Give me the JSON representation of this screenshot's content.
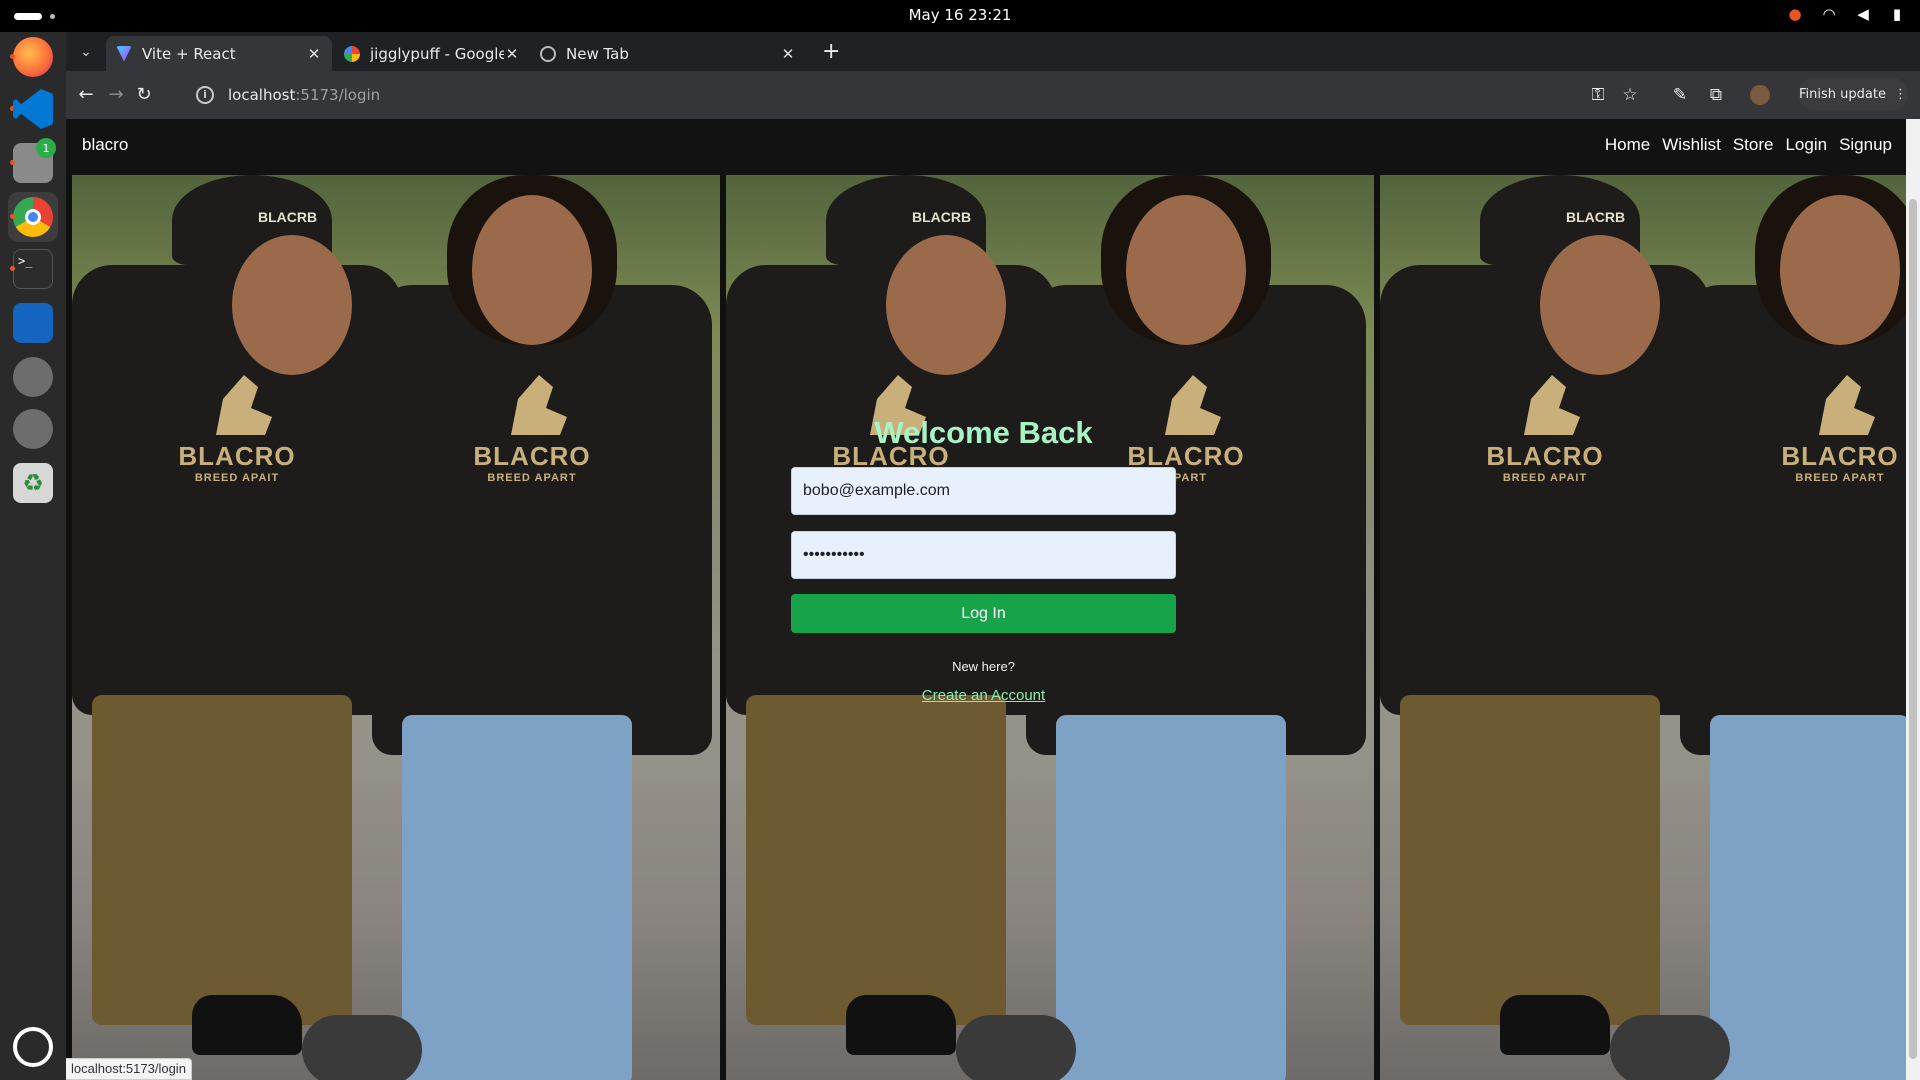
{
  "system": {
    "clock": "May 16  23:21",
    "tray": [
      "record-icon",
      "wifi-icon",
      "volume-icon",
      "battery-icon"
    ]
  },
  "dock": {
    "items": [
      {
        "name": "firefox",
        "color": "#ff7139"
      },
      {
        "name": "vscode",
        "color": "#0078d4"
      },
      {
        "name": "files",
        "color": "#8a8a8a",
        "badge": "1"
      },
      {
        "name": "chrome",
        "color": "#4285f4"
      },
      {
        "name": "terminal",
        "color": "#2c2c2c"
      },
      {
        "name": "writer",
        "color": "#1565c0"
      },
      {
        "name": "disc",
        "color": "#777"
      },
      {
        "name": "disc2",
        "color": "#777"
      },
      {
        "name": "trash",
        "color": "#3c8c3c"
      }
    ],
    "apps_icon": "ubuntu-apps-icon"
  },
  "browser": {
    "tabs": [
      {
        "title": "Vite + React",
        "favicon": "vite-icon",
        "active": true
      },
      {
        "title": "jigglypuff - Google Searc",
        "favicon": "google-icon",
        "active": false
      },
      {
        "title": "New Tab",
        "favicon": "chrome-icon",
        "active": false
      }
    ],
    "url_host": "localhost",
    "url_path": ":5173/login",
    "finish_update": "Finish update"
  },
  "site": {
    "brand": "blacro",
    "nav": [
      "Home",
      "Wishlist",
      "Store",
      "Login",
      "Signup"
    ],
    "hero_panels": [
      {
        "cap_text": "BLACRB",
        "logo": "BLACRO",
        "logo_sub": "BREED APAIT",
        "logo2": "BLACRO",
        "logo2_sub": "BREED APART"
      },
      {
        "cap_text": "BLACRB",
        "logo": "BLACRO",
        "logo_sub": "BR",
        "logo2": "BLACRO",
        "logo2_sub": "APART"
      },
      {
        "cap_text": "BLACRB",
        "logo": "BLACRO",
        "logo_sub": "BREED APAIT",
        "logo2": "BLACRO",
        "logo2_sub": "BREED APART"
      }
    ],
    "login": {
      "title": "Welcome Back",
      "email_value": "bobo@example.com",
      "password_value": "•••••••••••",
      "submit_label": "Log In",
      "new_here": "New here?",
      "create_account": "Create an Account"
    },
    "status_url": "localhost:5173/login"
  },
  "colors": {
    "accent_green": "#16a34a",
    "title_green": "#a7f3c4",
    "link_green": "#86efac"
  }
}
